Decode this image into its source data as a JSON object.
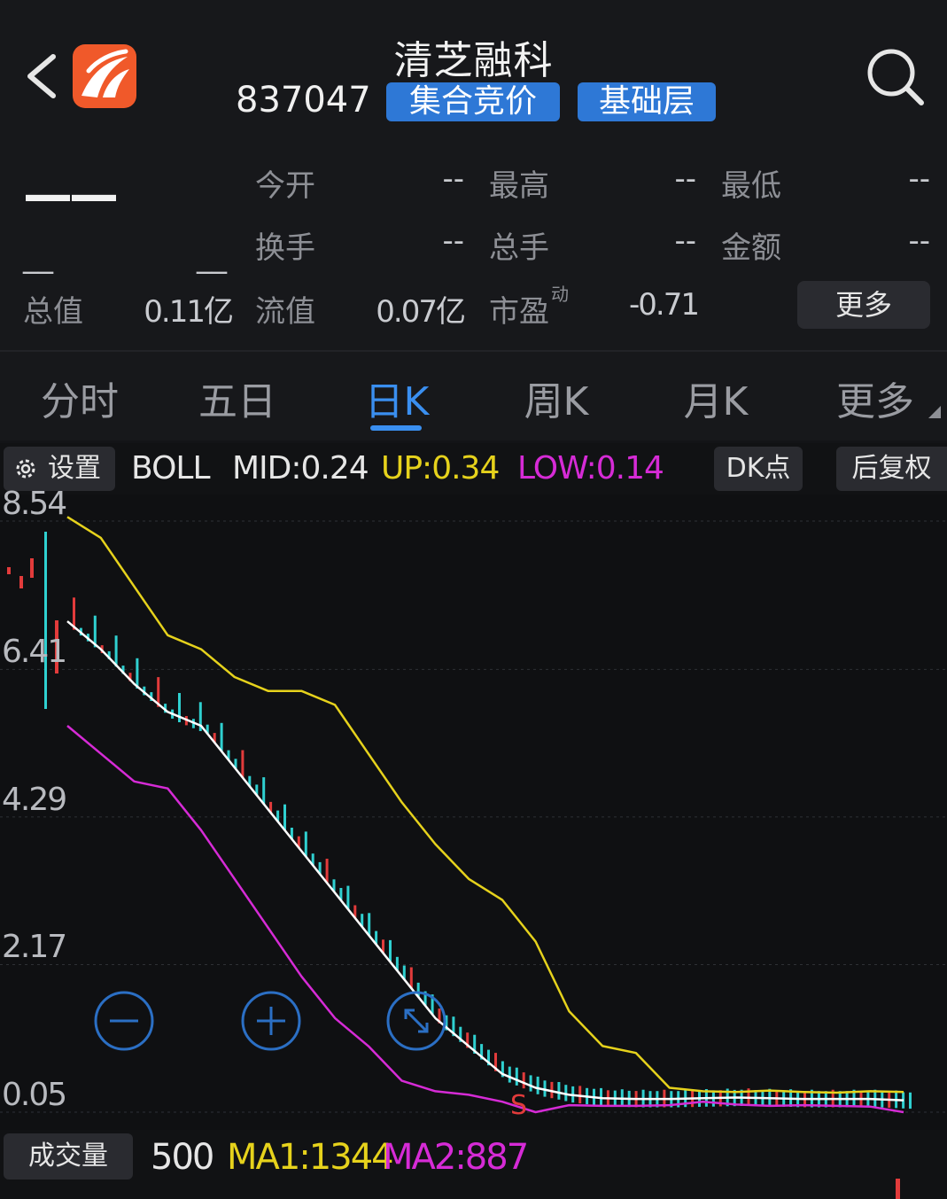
{
  "header": {
    "stock_name": "清芝融科",
    "stock_code": "837047",
    "badges": [
      "集合竞价",
      "基础层"
    ]
  },
  "quote": {
    "price": "——",
    "change": "__",
    "change_pct": "__",
    "fields": [
      {
        "label": "今开",
        "value": "--"
      },
      {
        "label": "最高",
        "value": "--"
      },
      {
        "label": "最低",
        "value": "--"
      },
      {
        "label": "换手",
        "value": "--"
      },
      {
        "label": "总手",
        "value": "--"
      },
      {
        "label": "金额",
        "value": "--"
      }
    ],
    "total_value_label": "总值",
    "total_value": "0.11亿",
    "float_value_label": "流值",
    "float_value": "0.07亿",
    "pe_label": "市盈",
    "pe_sup": "动",
    "pe_value": "-0.71",
    "more_label": "更多"
  },
  "tabs": [
    "分时",
    "五日",
    "日K",
    "周K",
    "月K",
    "更多"
  ],
  "active_tab": "日K",
  "indicator": {
    "settings_label": "设置",
    "name": "BOLL",
    "mid": "MID:0.24",
    "up": "UP:0.34",
    "low": "LOW:0.14",
    "dk_label": "DK点",
    "adjust_label": "后复权",
    "colors": {
      "mid": "#ffffff",
      "up": "#e6d21c",
      "low": "#d62bd6"
    }
  },
  "chart_data": {
    "type": "line",
    "y_ticks": [
      "8.54",
      "6.41",
      "4.29",
      "2.17",
      "0.05"
    ],
    "ylim": [
      0.05,
      8.54
    ],
    "marker": "S",
    "series": [
      {
        "name": "UP",
        "color": "#e6d21c",
        "values": [
          8.6,
          8.3,
          7.6,
          6.9,
          6.7,
          6.3,
          6.1,
          6.1,
          5.9,
          5.2,
          4.5,
          3.9,
          3.4,
          3.1,
          2.5,
          1.5,
          1.0,
          0.9,
          0.4,
          0.35,
          0.34,
          0.36,
          0.34,
          0.33,
          0.35,
          0.34
        ]
      },
      {
        "name": "MID",
        "color": "#ffffff",
        "values": [
          7.1,
          6.7,
          6.2,
          5.8,
          5.6,
          5.0,
          4.4,
          3.8,
          3.2,
          2.6,
          2.0,
          1.4,
          1.0,
          0.6,
          0.4,
          0.3,
          0.25,
          0.24,
          0.24,
          0.25,
          0.26,
          0.25,
          0.24,
          0.24,
          0.24,
          0.22
        ]
      },
      {
        "name": "LOW",
        "color": "#d62bd6",
        "values": [
          5.6,
          5.2,
          4.8,
          4.7,
          4.1,
          3.4,
          2.7,
          2.0,
          1.4,
          1.0,
          0.5,
          0.35,
          0.3,
          0.2,
          0.05,
          0.15,
          0.14,
          0.14,
          0.15,
          0.2,
          0.16,
          0.14,
          0.15,
          0.14,
          0.13,
          0.05
        ]
      }
    ]
  },
  "volume": {
    "label": "成交量",
    "value": "500",
    "ma1": "MA1:1344",
    "ma2": "MA2:887",
    "colors": {
      "ma1": "#e6d21c",
      "ma2": "#d62bd6"
    }
  }
}
